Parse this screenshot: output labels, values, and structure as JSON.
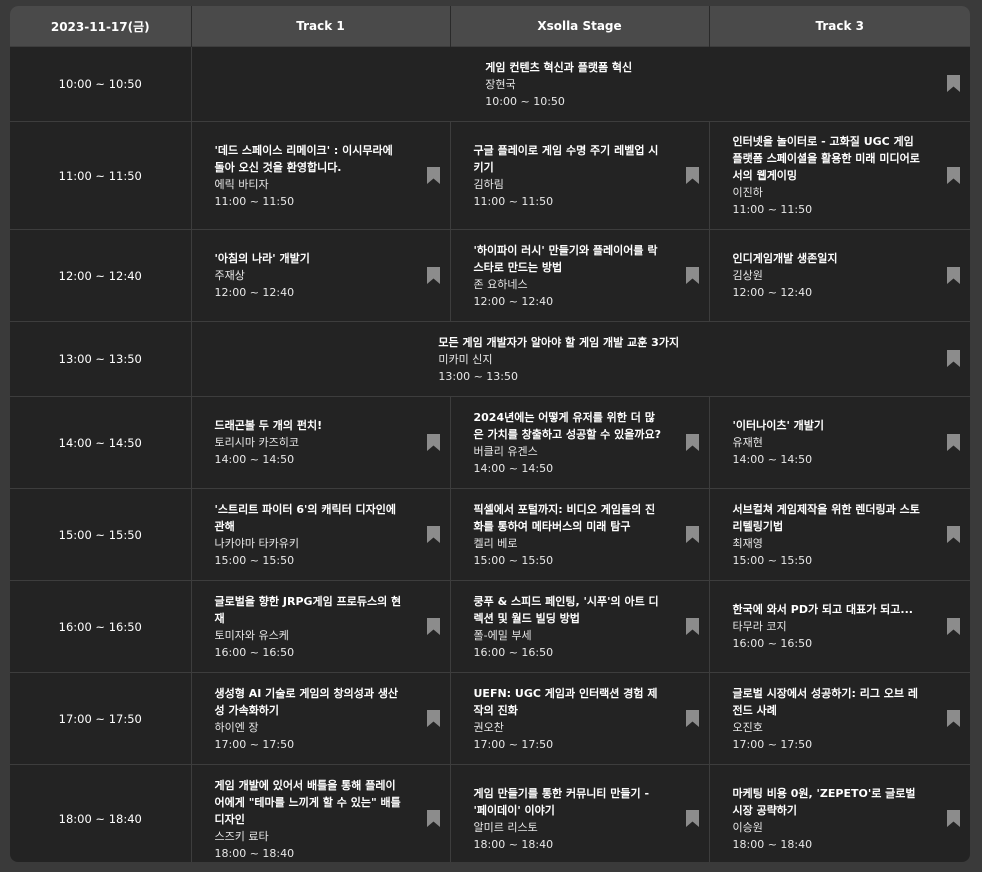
{
  "header": {
    "date": "2023-11-17(금)",
    "tracks": [
      "Track 1",
      "Xsolla Stage",
      "Track 3"
    ]
  },
  "rows": [
    {
      "time": "10:00 ~ 10:50",
      "full": {
        "title": "게임 컨텐츠 혁신과 플랫폼 혁신",
        "speaker": "장현국",
        "time": "10:00 ~ 10:50"
      }
    },
    {
      "time": "11:00 ~ 11:50",
      "sessions": [
        {
          "title": "'데드 스페이스 리메이크' : 이시무라에 돌아 오신 것을 환영합니다.",
          "speaker": "에릭 바티자",
          "time": "11:00 ~ 11:50"
        },
        {
          "title": "구글 플레이로 게임 수명 주기 레벨업 시키기",
          "speaker": "김하림",
          "time": "11:00 ~ 11:50"
        },
        {
          "title": "인터넷을 놀이터로 - 고화질 UGC 게임 플랫폼 스페이셜을 활용한 미래 미디어로서의 웹게이밍",
          "speaker": "이진하",
          "time": "11:00 ~ 11:50"
        }
      ]
    },
    {
      "time": "12:00 ~ 12:40",
      "sessions": [
        {
          "title": "'아침의 나라' 개발기",
          "speaker": "주재상",
          "time": "12:00 ~ 12:40"
        },
        {
          "title": "'하이파이 러시' 만들기와 플레이어를 락스타로 만드는 방법",
          "speaker": "존 요하네스",
          "time": "12:00 ~ 12:40"
        },
        {
          "title": "인디게임개발 생존일지",
          "speaker": "김상원",
          "time": "12:00 ~ 12:40"
        }
      ]
    },
    {
      "time": "13:00 ~ 13:50",
      "full": {
        "title": "모든 게임 개발자가 알아야 할 게임 개발 교훈 3가지",
        "speaker": "미카미 신지",
        "time": "13:00 ~ 13:50"
      }
    },
    {
      "time": "14:00 ~ 14:50",
      "sessions": [
        {
          "title": "드래곤볼 두 개의 펀치!",
          "speaker": "토리시마 카즈히코",
          "time": "14:00 ~ 14:50"
        },
        {
          "title": "2024년에는 어떻게 유저를 위한 더 많은 가치를 창출하고 성공할 수 있을까요?",
          "speaker": "버클리 유겐스",
          "time": "14:00 ~ 14:50"
        },
        {
          "title": "'이터나이츠' 개발기",
          "speaker": "유재현",
          "time": "14:00 ~ 14:50"
        }
      ]
    },
    {
      "time": "15:00 ~ 15:50",
      "sessions": [
        {
          "title": "'스트리트 파이터 6'의 캐릭터 디자인에 관해",
          "speaker": "나카야마 타카유키",
          "time": "15:00 ~ 15:50"
        },
        {
          "title": "픽셀에서 포털까지: 비디오 게임들의 진화를 통하여 메타버스의 미래 탐구",
          "speaker": "켈리 베로",
          "time": "15:00 ~ 15:50"
        },
        {
          "title": "서브컬쳐 게임제작을 위한 렌더링과 스토리텔링기법",
          "speaker": "최재영",
          "time": "15:00 ~ 15:50"
        }
      ]
    },
    {
      "time": "16:00 ~ 16:50",
      "sessions": [
        {
          "title": "글로벌을 향한 JRPG게임 프로듀스의 현재",
          "speaker": "토미자와 유스케",
          "time": "16:00 ~ 16:50"
        },
        {
          "title": "쿵푸 & 스피드 페인팅, '시푸'의 아트 디렉션 및 월드 빌딩 방법",
          "speaker": "폴-에밀 부세",
          "time": "16:00 ~ 16:50"
        },
        {
          "title": "한국에 와서 PD가 되고 대표가 되고...",
          "speaker": "타무라 코지",
          "time": "16:00 ~ 16:50"
        }
      ]
    },
    {
      "time": "17:00 ~ 17:50",
      "sessions": [
        {
          "title": "생성형 AI 기술로 게임의 창의성과 생산성 가속화하기",
          "speaker": "하이엔 장",
          "time": "17:00 ~ 17:50"
        },
        {
          "title": "UEFN: UGC 게임과 인터랙션 경험 제작의 진화",
          "speaker": "권오찬",
          "time": "17:00 ~ 17:50"
        },
        {
          "title": "글로벌 시장에서 성공하기: 리그 오브 레전드 사례",
          "speaker": "오진호",
          "time": "17:00 ~ 17:50"
        }
      ]
    },
    {
      "time": "18:00 ~ 18:40",
      "sessions": [
        {
          "title": "게임 개발에 있어서 배틀을 통해 플레이어에게 \"테마를 느끼게 할 수 있는\" 배틀 디자인",
          "speaker": "스즈키 료타",
          "time": "18:00 ~ 18:40"
        },
        {
          "title": "게임 만들기를 통한 커뮤니티 만들기 - '페이데이' 이야기",
          "speaker": "알미르 리스토",
          "time": "18:00 ~ 18:40"
        },
        {
          "title": "마케팅 비용 0원, 'ZEPETO'로 글로벌 시장 공략하기",
          "speaker": "이승원",
          "time": "18:00 ~ 18:40"
        }
      ]
    }
  ],
  "icons": {
    "bookmark": "bookmark-icon"
  },
  "colors": {
    "background": "#232323",
    "header": "#4a4a4a",
    "bookmark": "#8c8c8c"
  }
}
